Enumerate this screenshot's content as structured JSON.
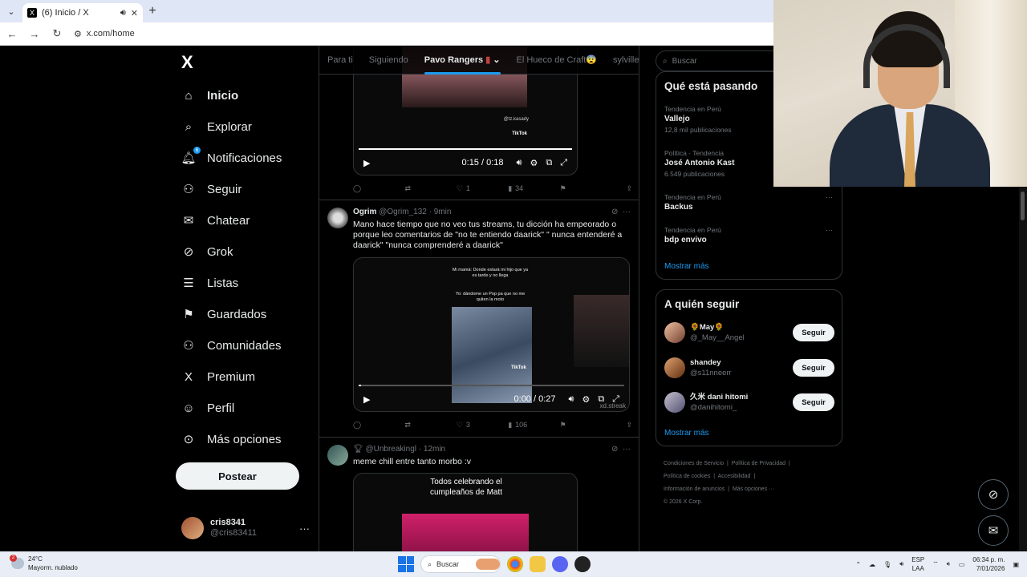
{
  "browser": {
    "tab_title": "(6) Inicio / X",
    "url": "x.com/home"
  },
  "sidebar": {
    "logo": "X",
    "items": [
      {
        "label": "Inicio",
        "icon": "home-icon",
        "glyph": "⌂"
      },
      {
        "label": "Explorar",
        "icon": "search-icon",
        "glyph": "⌕"
      },
      {
        "label": "Notificaciones",
        "icon": "bell-icon",
        "glyph": "🔔︎",
        "badge": "6"
      },
      {
        "label": "Seguir",
        "icon": "person-add-icon",
        "glyph": "⚇"
      },
      {
        "label": "Chatear",
        "icon": "mail-icon",
        "glyph": "✉"
      },
      {
        "label": "Grok",
        "icon": "grok-icon",
        "glyph": "⊘"
      },
      {
        "label": "Listas",
        "icon": "list-icon",
        "glyph": "☰"
      },
      {
        "label": "Guardados",
        "icon": "bookmark-icon",
        "glyph": "⚑"
      },
      {
        "label": "Comunidades",
        "icon": "people-icon",
        "glyph": "⚇"
      },
      {
        "label": "Premium",
        "icon": "x-premium-icon",
        "glyph": "X"
      },
      {
        "label": "Perfil",
        "icon": "profile-icon",
        "glyph": "☺"
      },
      {
        "label": "Más opciones",
        "icon": "more-circle-icon",
        "glyph": "⊙"
      }
    ],
    "post_label": "Postear",
    "user_name": "cris8341",
    "user_handle": "@cris83411"
  },
  "timeline": {
    "tabs": [
      "Para ti",
      "Siguiendo",
      "Pavo Rangers",
      "El Hueco de Craft",
      "sylville"
    ],
    "tweet1": {
      "time": "0:15 / 0:18",
      "replies": "",
      "retweets": "",
      "likes": "1",
      "views": "34",
      "tiktok": "TikTok",
      "handle_overlay": "@tz.kasady"
    },
    "tweet2": {
      "name": "Ogrim",
      "handle": "@Ogrim_132 · 9min",
      "text": "Mano hace tiempo que no veo tus streams, tu dicción ha empeorado o porque leo comentarios de \"no te entiendo daarick\" \" nunca entenderé a daarick\" \"nunca comprenderé a daarick\"",
      "video_caption": "Mi mamá: Donde estará mi hijo que ya es tarde y no llega",
      "video_caption2": "Yo: dándome un Pop pa que no me quiten la moto",
      "time": "0:00 / 0:27",
      "likes": "3",
      "views": "106",
      "tiktok": "TikTok",
      "watermark": "xd.streak"
    },
    "tweet3": {
      "handle": "@Unbreakingl · 12min",
      "text": "meme chill entre tanto morbo :v",
      "media_text": "Todos celebrando el cumpleaños de Matt"
    }
  },
  "right": {
    "search_placeholder": "Buscar",
    "trends_title": "Qué está pasando",
    "trends": [
      {
        "context": "Tendencia en Perú",
        "name": "Vallejo",
        "count": "12,8 mil publicaciones"
      },
      {
        "context": "Política · Tendencia",
        "name": "José Antonio Kast",
        "count": "6.549 publicaciones"
      },
      {
        "context": "Tendencia en Perú",
        "name": "Backus",
        "count": ""
      },
      {
        "context": "Tendencia en Perú",
        "name": "bdp envivo",
        "count": ""
      }
    ],
    "show_more": "Mostrar más",
    "who_title": "A quién seguir",
    "who": [
      {
        "name": "🌻May🌻",
        "handle": "@_May__Angel",
        "button": "Seguir"
      },
      {
        "name": "shandey",
        "handle": "@s11nneerr",
        "button": "Seguir"
      },
      {
        "name": "久米 dani hitomi",
        "handle": "@danihitomi_",
        "button": "Seguir"
      }
    ],
    "show_more2": "Mostrar más",
    "footer": [
      "Condiciones de Servicio",
      "Política de Privacidad",
      "Política de cookies",
      "Accesibilidad",
      "Información de anuncios",
      "Más opciones ···",
      "© 2026 X Corp."
    ]
  },
  "taskbar": {
    "temp": "24°C",
    "weather": "Mayorm. nublado",
    "weather_badge": "2",
    "search": "Buscar",
    "lang1": "ESP",
    "lang2": "LAA",
    "time": "06:34 p. m.",
    "date": "7/01/2026"
  },
  "colors": {
    "accent": "#1d9bf0",
    "bg": "#000000",
    "text": "#e7e9ea",
    "muted": "#71767b",
    "border": "#2f3336"
  }
}
